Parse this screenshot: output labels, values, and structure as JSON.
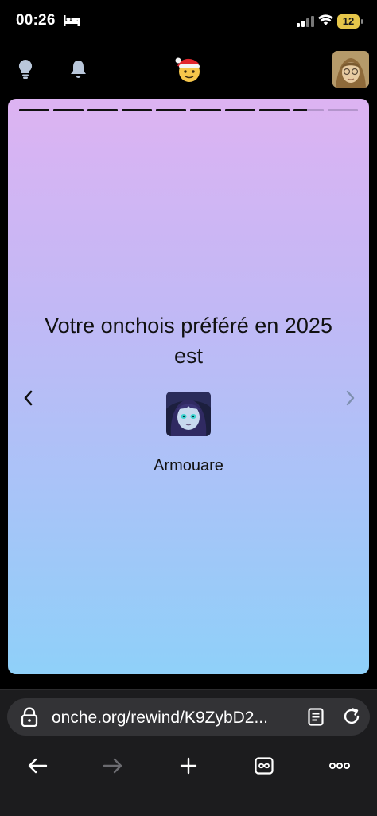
{
  "status_bar": {
    "time": "00:26",
    "battery": "12"
  },
  "header": {
    "icons": [
      "lightbulb-icon",
      "bell-icon",
      "santa-logo",
      "user-avatar"
    ]
  },
  "story": {
    "progress_total": 10,
    "progress_completed": 8,
    "progress_current_fraction": 0.45,
    "title": "Votre onchois préféré en 2025 est",
    "favorite_name": "Armouare"
  },
  "browser": {
    "url": "onche.org/rewind/K9ZybD2..."
  },
  "colors": {
    "card_top": "#ddb3f2",
    "card_bottom": "#8fd0f9",
    "battery": "#e6c64a"
  }
}
